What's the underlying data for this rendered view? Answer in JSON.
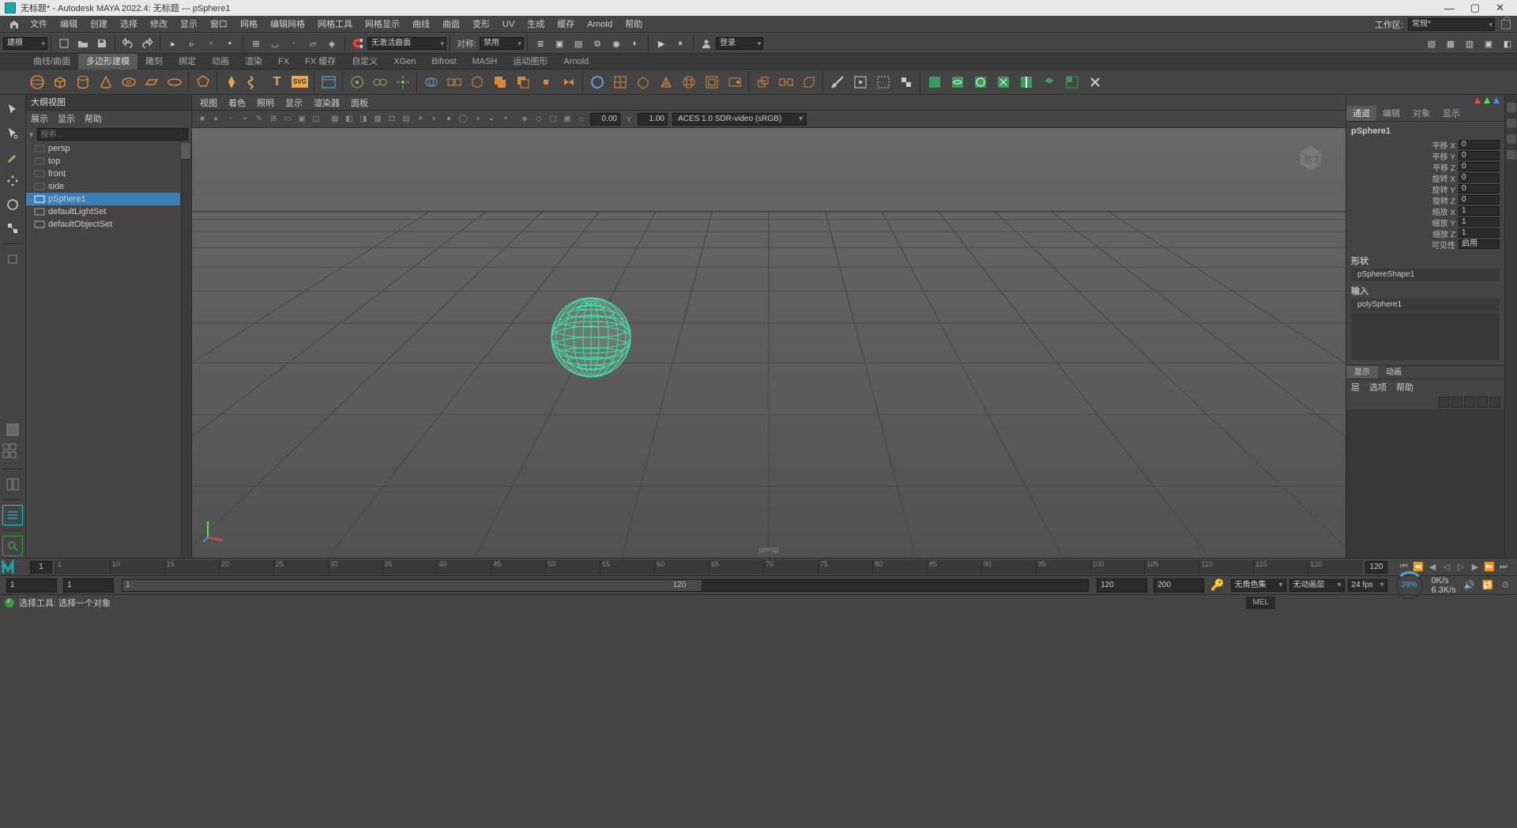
{
  "title": "无标题* - Autodesk MAYA 2022.4: 无标题   ---   pSphere1",
  "menus": [
    "文件",
    "编辑",
    "创建",
    "选择",
    "修改",
    "显示",
    "窗口",
    "网格",
    "编辑网格",
    "网格工具",
    "网格显示",
    "曲线",
    "曲面",
    "变形",
    "UV",
    "生成",
    "缓存",
    "Arnold",
    "帮助"
  ],
  "workspace": {
    "label": "工作区:",
    "value": "常规*"
  },
  "modeDropdown": "建模",
  "shelfBar": {
    "noActive": "无激活曲面",
    "symLabel": "对称:",
    "symValue": "禁用",
    "login": "登录"
  },
  "shelfTabs": [
    "曲线/曲面",
    "多边形建模",
    "雕刻",
    "绑定",
    "动画",
    "渲染",
    "FX",
    "FX 缓存",
    "自定义",
    "XGen",
    "Bifrost",
    "MASH",
    "运动图形",
    "Arnold"
  ],
  "activeShelfTab": 1,
  "outliner": {
    "title": "大纲视图",
    "menus": [
      "展示",
      "显示",
      "帮助"
    ],
    "search": "搜索...",
    "nodes": [
      {
        "label": "persp",
        "dim": true
      },
      {
        "label": "top",
        "dim": true
      },
      {
        "label": "front",
        "dim": true
      },
      {
        "label": "side",
        "dim": true
      },
      {
        "label": "pSphere1",
        "sel": true
      },
      {
        "label": "defaultLightSet"
      },
      {
        "label": "defaultObjectSet"
      }
    ]
  },
  "viewport": {
    "menus": [
      "视图",
      "着色",
      "照明",
      "显示",
      "渲染器",
      "面板"
    ],
    "num1": "0.00",
    "num2": "1.00",
    "colorspace": "ACES 1.0 SDR-video (sRGB)",
    "persp": "persp",
    "cubeFront": "前",
    "cubeRight": "右"
  },
  "channel": {
    "tabs": [
      "通道",
      "编辑",
      "对象",
      "显示"
    ],
    "activeTab": 0,
    "object": "pSphere1",
    "attrs": [
      {
        "l": "平移 X",
        "v": "0"
      },
      {
        "l": "平移 Y",
        "v": "0"
      },
      {
        "l": "平移 Z",
        "v": "0"
      },
      {
        "l": "旋转 X",
        "v": "0"
      },
      {
        "l": "旋转 Y",
        "v": "0"
      },
      {
        "l": "旋转 Z",
        "v": "0"
      },
      {
        "l": "缩放 X",
        "v": "1"
      },
      {
        "l": "缩放 Y",
        "v": "1"
      },
      {
        "l": "缩放 Z",
        "v": "1"
      },
      {
        "l": "可见性",
        "v": "启用"
      }
    ],
    "shapeHdr": "形状",
    "shape": "pSphereShape1",
    "inputHdr": "输入",
    "input": "polySphere1"
  },
  "layer": {
    "tabs": [
      "显示",
      "动画"
    ],
    "active": 0,
    "menus": [
      "层",
      "选项",
      "帮助"
    ]
  },
  "time": {
    "cur": "1",
    "start": "1",
    "end": "120",
    "rstart": "1",
    "rend": "120",
    "r3": "120",
    "r4": "200",
    "ticks": [
      "1",
      "10",
      "15",
      "20",
      "25",
      "30",
      "35",
      "40",
      "45",
      "50",
      "55",
      "60",
      "65",
      "70",
      "75",
      "80",
      "85",
      "90",
      "95",
      "100",
      "105",
      "110",
      "115",
      "120"
    ]
  },
  "range": {
    "noCharSet": "无角色集",
    "noAnimLayer": "无动画层",
    "fps": "24 fps",
    "gauge": "39%",
    "rate1": "0K/s",
    "rate2": "6.3K/s"
  },
  "status": "选择工具: 选择一个对象",
  "mel": "MEL"
}
